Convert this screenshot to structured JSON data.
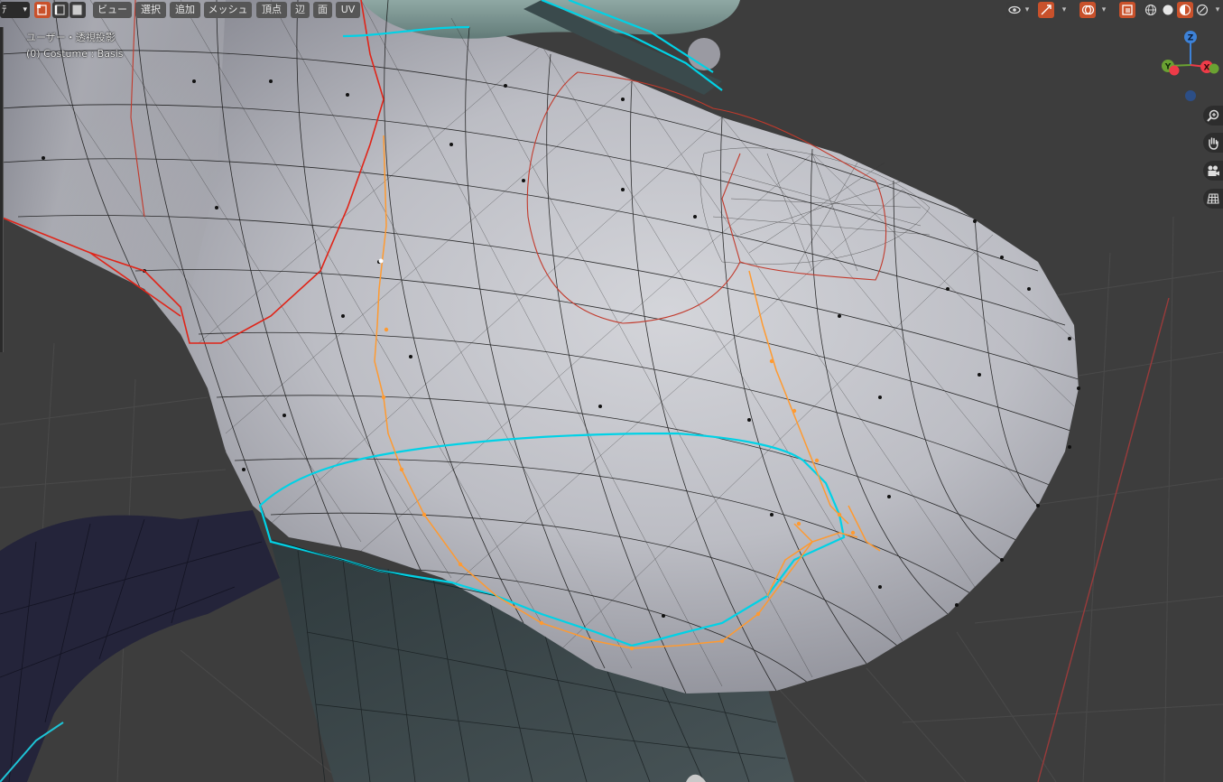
{
  "header": {
    "mode_fragment": "ﾃ",
    "menu": {
      "view": "ビュー",
      "select": "選択",
      "add": "追加",
      "mesh": "メッシュ",
      "vertex": "頂点",
      "edge": "辺",
      "face": "面",
      "uv": "UV"
    },
    "select_modes": [
      "vertex-select-icon",
      "edge-select-icon",
      "face-select-icon"
    ],
    "active_select_mode": "vertex",
    "right_icons": [
      "visibility-icon",
      "gizmo-icon",
      "overlay-icon",
      "xray-icon",
      "wireframe-shading-icon",
      "solid-shading-icon",
      "material-shading-icon",
      "rendered-shading-icon"
    ]
  },
  "viewport_info": {
    "view_name": "ユーザー・透視投影",
    "object_line": "(0) Costume : Basis"
  },
  "gizmo": {
    "z_label": "Z",
    "y_label": "Y",
    "x_label": "X",
    "colors": {
      "x": "#ee3b48",
      "y": "#6aa232",
      "z": "#3d82d8"
    }
  },
  "nav_buttons": [
    "zoom-icon",
    "pan-hand-icon",
    "camera-icon",
    "grid-ortho-icon"
  ],
  "colors": {
    "background": "#3d3d3d",
    "accent": "#c9512b",
    "selected_edge": "#ff9a30",
    "seam": "#e0291a",
    "sharp_edge": "#00d2e6",
    "mesh_surface": "#b8b9c0"
  }
}
